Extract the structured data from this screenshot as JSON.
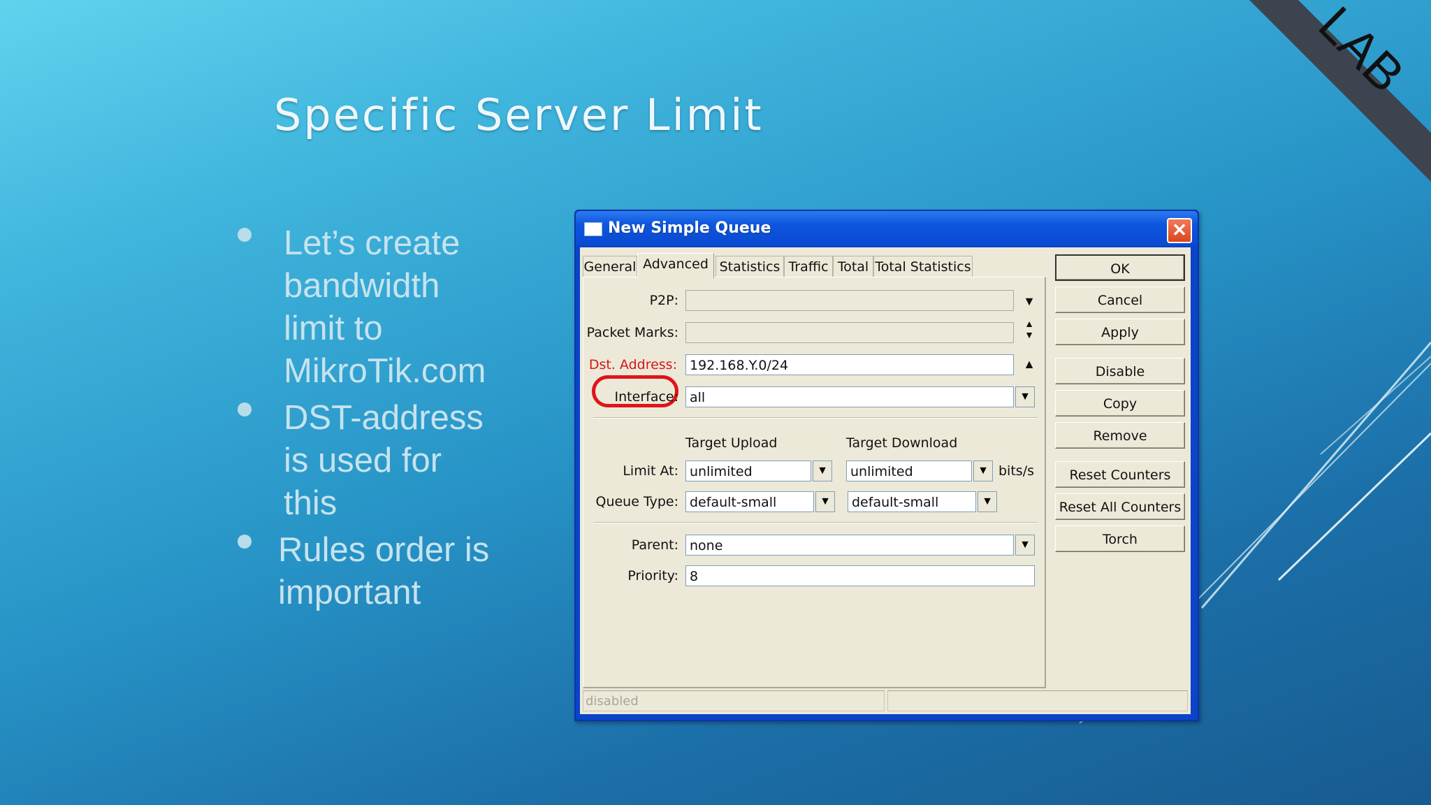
{
  "slide": {
    "title": "Specific Server Limit",
    "bullets": [
      "Let’s create\nbandwidth\nlimit to\nMikroTik.com",
      "DST-address\nis used for\nthis",
      "Rules order is\nimportant"
    ],
    "corner_label": "LAB"
  },
  "window": {
    "title": "New Simple Queue",
    "close_symbol": "✕",
    "tabs": [
      "General",
      "Advanced",
      "Statistics",
      "Traffic",
      "Total",
      "Total Statistics"
    ],
    "active_tab": "Advanced",
    "fields": {
      "p2p": {
        "label": "P2P:",
        "value": ""
      },
      "packet_marks": {
        "label": "Packet Marks:",
        "value": ""
      },
      "dst_address": {
        "label": "Dst. Address:",
        "value": "192.168.Y.0/24"
      },
      "interface": {
        "label": "Interface:",
        "value": "all"
      },
      "target_upload_header": "Target Upload",
      "target_download_header": "Target Download",
      "limit_at": {
        "label": "Limit At:",
        "upload": "unlimited",
        "download": "unlimited",
        "unit": "bits/s"
      },
      "queue_type": {
        "label": "Queue Type:",
        "upload": "default-small",
        "download": "default-small"
      },
      "parent": {
        "label": "Parent:",
        "value": "none"
      },
      "priority": {
        "label": "Priority:",
        "value": "8"
      }
    },
    "buttons": [
      "OK",
      "Cancel",
      "Apply",
      "Disable",
      "Copy",
      "Remove",
      "Reset Counters",
      "Reset All Counters",
      "Torch"
    ],
    "status": {
      "left": "disabled",
      "right": ""
    },
    "highlight_color": "#e0141a"
  }
}
